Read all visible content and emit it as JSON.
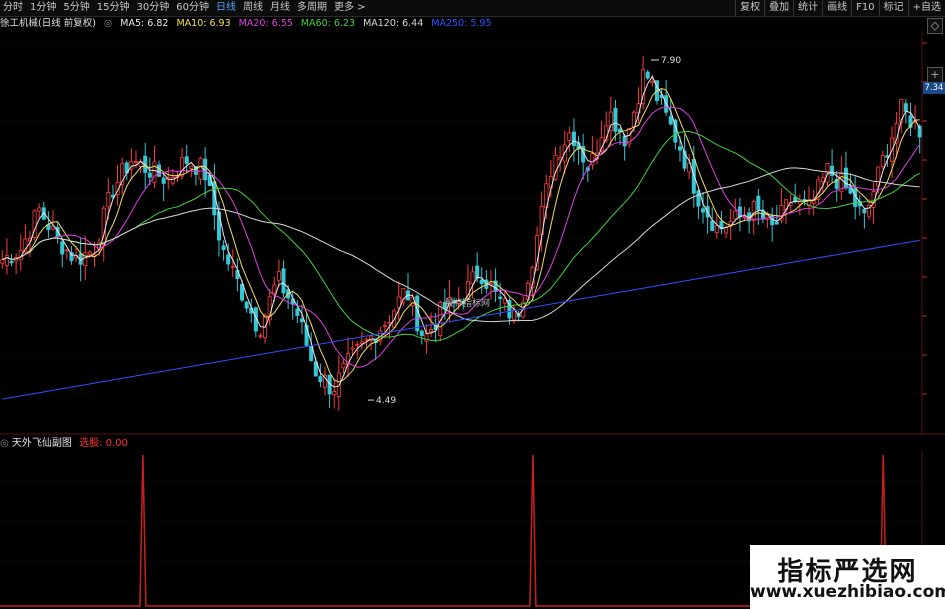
{
  "toolbar": {
    "periods": [
      "分时",
      "1分钟",
      "5分钟",
      "15分钟",
      "30分钟",
      "60分钟",
      "日线",
      "周线",
      "月线",
      "多周期",
      "更多 >"
    ],
    "active_period": "日线",
    "right_buttons": [
      "复权",
      "叠加",
      "统计",
      "画线",
      "F10",
      "标记",
      "+自选"
    ]
  },
  "infobar": {
    "stock": "徐工机械(日线 前复权)",
    "ma5": "MA5: 6.82",
    "ma10": "MA10: 6.93",
    "ma20": "MA20: 6.55",
    "ma60": "MA60: 6.23",
    "ma120": "MA120: 6.44",
    "ma250": "MA250: 5.95"
  },
  "price_axis": {
    "last_price": "7.34"
  },
  "annotations": {
    "high": "7.90",
    "low": "4.49",
    "center_watermark": "股标指标网"
  },
  "sub_indicator": {
    "name": "天外飞仙副图",
    "signal": "选股: 0.00"
  },
  "watermark": {
    "line1": "指标严选网",
    "line2": "www.xuezhibiao.com"
  },
  "colors": {
    "up": "#ff3b3b",
    "down": "#36c7d6",
    "ma5": "#e8e8e8",
    "ma10": "#f0e060",
    "ma20": "#e040e0",
    "ma60": "#40d040",
    "ma120": "#d8d8d8",
    "ma250": "#3050ff",
    "signal": "#c82020"
  },
  "chart_data": {
    "type": "candlestick",
    "high_mark": 7.9,
    "low_mark": 4.49,
    "ohlc_anchor_closes": [
      5.9,
      6.0,
      6.4,
      6.1,
      5.9,
      6.0,
      6.6,
      6.9,
      6.8,
      6.7,
      6.9,
      6.8,
      6.0,
      5.6,
      5.2,
      5.7,
      5.4,
      4.8,
      4.6,
      4.9,
      5.1,
      5.3,
      5.6,
      5.1,
      5.4,
      5.5,
      5.8,
      5.5,
      5.3,
      6.0,
      6.9,
      7.2,
      6.8,
      7.4,
      7.1,
      7.8,
      7.4,
      7.0,
      6.5,
      6.2,
      6.3,
      6.4,
      6.2,
      6.5,
      6.4,
      6.8,
      6.6,
      6.3,
      6.9,
      7.4,
      7.2
    ],
    "signal_spike_positions": [
      0.155,
      0.578,
      0.958
    ]
  }
}
